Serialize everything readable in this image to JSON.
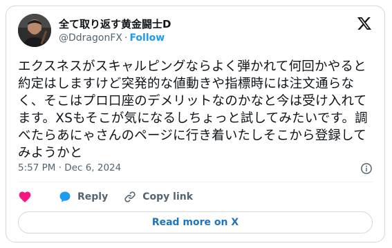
{
  "author": {
    "display_name": "全て取り返す黄金闘士D",
    "handle": "@DdragonFX",
    "separator": "·",
    "follow_label": "Follow"
  },
  "tweet": {
    "text": "エクスネスがスキャルピングならよく弾かれて何回かやると約定はしますけど突発的な値動きや指標時には注文通らなく、そこはプロ口座のデメリットなのかなと今は受け入れてます。XSもそこが気になるしちょっと試してみたいです。調べたらあにゃさんのページに行き着いたしそこから登録してみようかと",
    "time": "5:57 PM",
    "separator": "·",
    "date": "Dec 6, 2024"
  },
  "actions": {
    "reply_label": "Reply",
    "copy_link_label": "Copy link"
  },
  "read_more_label": "Read more on X",
  "colors": {
    "accent": "#1d9bf0",
    "like": "#f91880",
    "text": "#0f1419",
    "muted": "#536471",
    "border": "#cfd9de"
  },
  "icons": [
    "x-logo-icon",
    "info-icon",
    "heart-icon",
    "reply-bubble-icon",
    "link-icon"
  ]
}
